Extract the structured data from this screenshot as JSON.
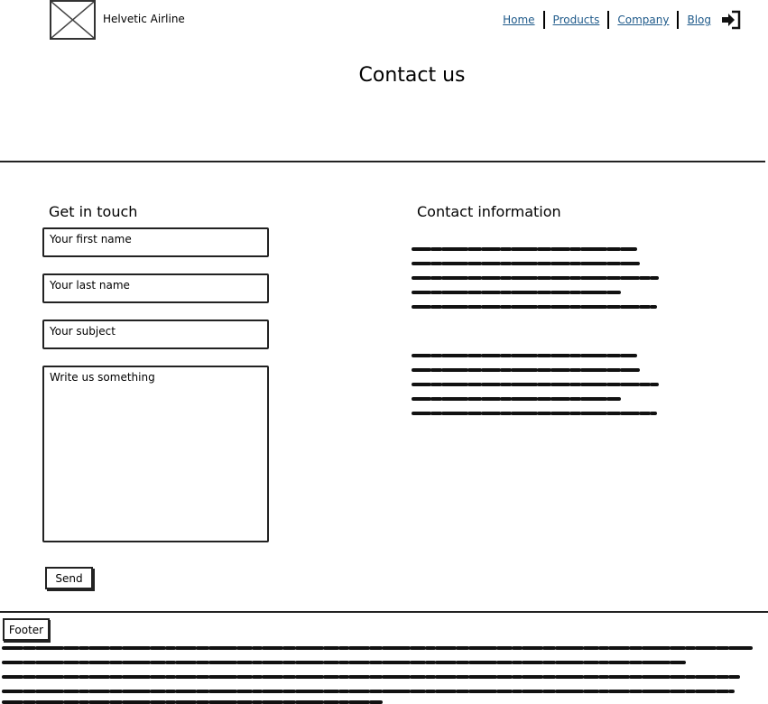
{
  "header": {
    "logo": "image-placeholder-icon",
    "brand": "Helvetic Airline",
    "nav": [
      "Home",
      "Products",
      "Company",
      "Blog"
    ],
    "login_icon": "sign-in-icon"
  },
  "page_title": "Contact us",
  "contact_form": {
    "heading": "Get in touch",
    "first_name_placeholder": "Your first name",
    "last_name_placeholder": "Your last name",
    "subject_placeholder": "Your subject",
    "message_placeholder": "Write us something",
    "send_label": "Send"
  },
  "contact_info": {
    "heading": "Contact information"
  },
  "footer": {
    "label": "Footer"
  },
  "colors": {
    "link": "#1f5a8a",
    "ink": "#222222"
  }
}
